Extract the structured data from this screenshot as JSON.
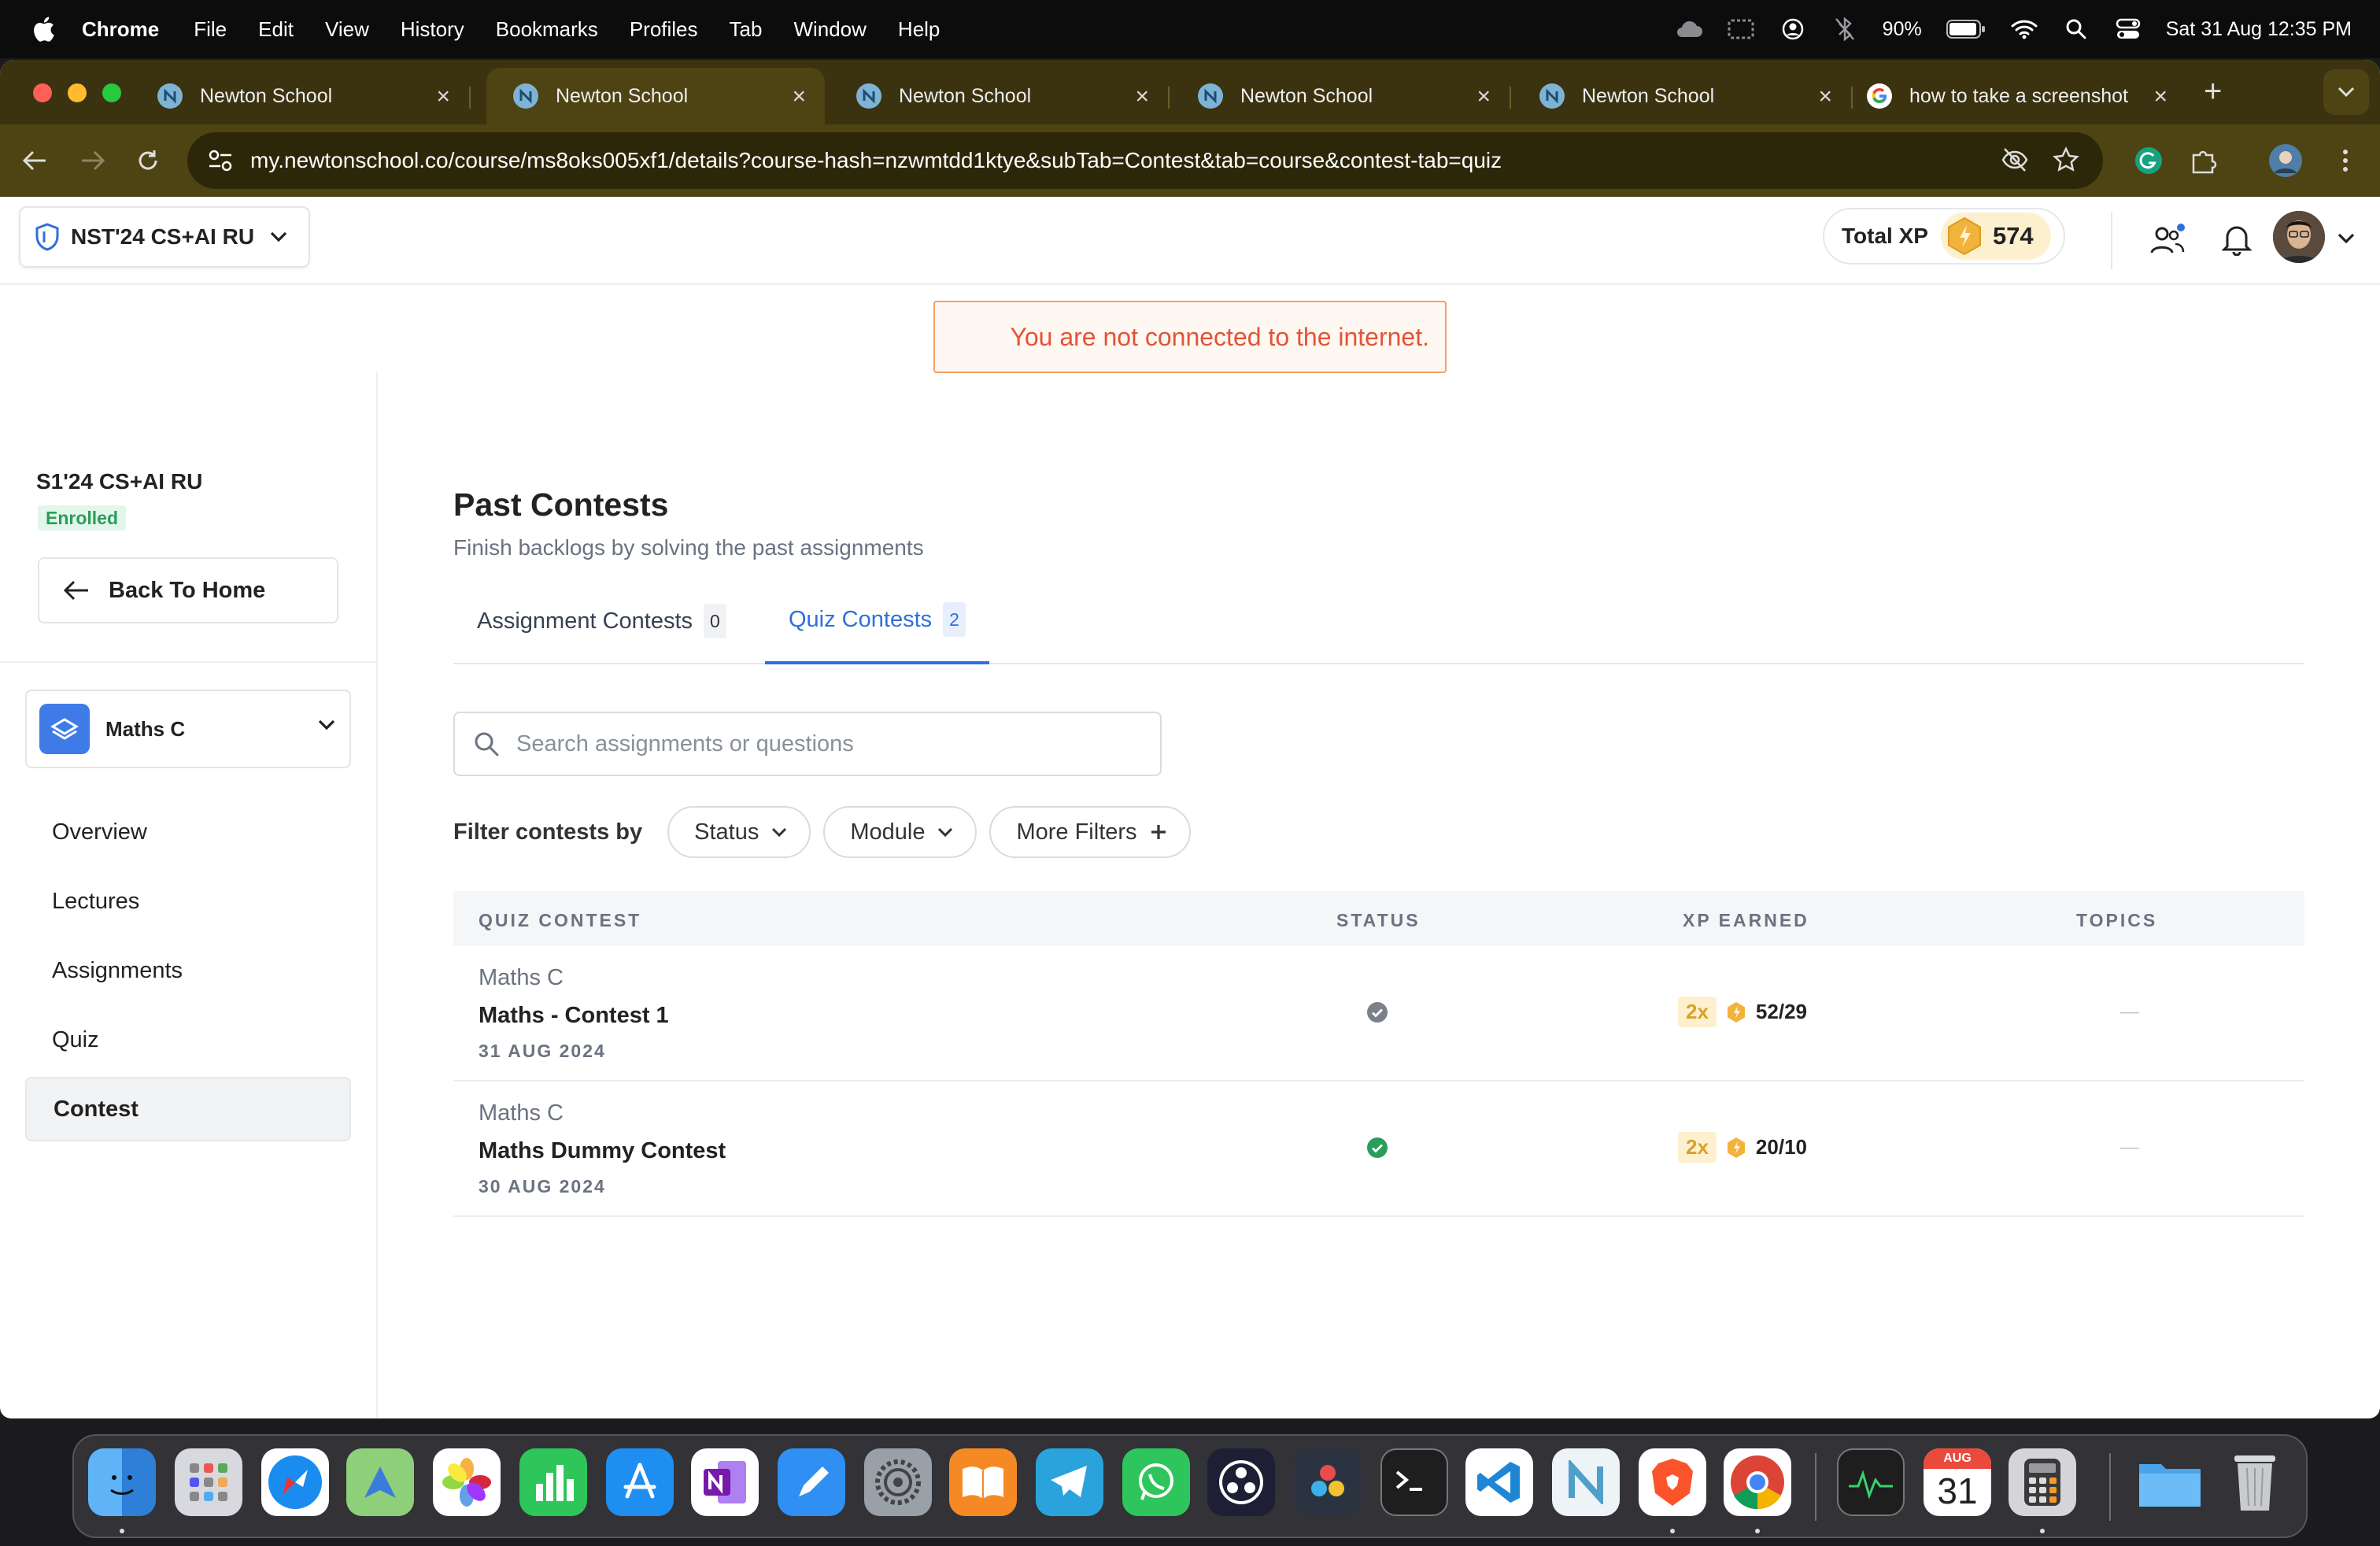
{
  "menubar": {
    "app": "Chrome",
    "items": [
      "File",
      "Edit",
      "View",
      "History",
      "Bookmarks",
      "Profiles",
      "Tab",
      "Window",
      "Help"
    ],
    "battery": "90%",
    "datetime": "Sat 31 Aug  12:35 PM"
  },
  "browser": {
    "tabs": [
      {
        "title": "Newton School",
        "active": false
      },
      {
        "title": "Newton School",
        "active": true
      },
      {
        "title": "Newton School",
        "active": false
      },
      {
        "title": "Newton School",
        "active": false
      },
      {
        "title": "Newton School",
        "active": false
      },
      {
        "title": "how to take a screenshot",
        "active": false
      }
    ],
    "url": "my.newtonschool.co/course/ms8oks005xf1/details?course-hash=nzwmtdd1ktye&subTab=Contest&tab=course&contest-tab=quiz"
  },
  "header": {
    "course_switcher": "NST'24 CS+AI RU",
    "total_xp_label": "Total XP",
    "total_xp_value": "574"
  },
  "alert": {
    "message": "You are not connected to the internet."
  },
  "sidebar": {
    "course_title": "S1'24 CS+AI RU",
    "enrolled_badge": "Enrolled",
    "back_button": "Back To Home",
    "subject": "Maths C",
    "nav": [
      {
        "label": "Overview",
        "active": false
      },
      {
        "label": "Lectures",
        "active": false
      },
      {
        "label": "Assignments",
        "active": false
      },
      {
        "label": "Quiz",
        "active": false
      },
      {
        "label": "Contest",
        "active": true
      }
    ]
  },
  "main": {
    "title": "Past Contests",
    "subtitle": "Finish backlogs by solving the past assignments",
    "tabs": [
      {
        "label": "Assignment Contests",
        "count": "0",
        "active": false
      },
      {
        "label": "Quiz Contests",
        "count": "2",
        "active": true
      }
    ],
    "search_placeholder": "Search assignments or questions",
    "filter_label": "Filter contests by",
    "filters": [
      "Status",
      "Module",
      "More Filters"
    ],
    "table": {
      "columns": [
        "QUIZ CONTEST",
        "STATUS",
        "XP EARNED",
        "TOPICS"
      ],
      "rows": [
        {
          "subject": "Maths C",
          "name": "Maths - Contest 1",
          "date": "31 AUG 2024",
          "status": "completed-grey",
          "multiplier": "2x",
          "xp": "52/29",
          "topics": "—"
        },
        {
          "subject": "Maths C",
          "name": "Maths Dummy Contest",
          "date": "30 AUG 2024",
          "status": "completed-green",
          "multiplier": "2x",
          "xp": "20/10",
          "topics": "—"
        }
      ]
    }
  },
  "colors": {
    "accent": "#2f6fdc",
    "alert_text": "#e25436",
    "alert_border": "#f0a06a",
    "status_green": "#2a9d5c",
    "status_grey": "#7c8189"
  },
  "dock": {
    "apps": [
      "finder-icon",
      "launchpad-icon",
      "safari-icon",
      "maps-icon",
      "photos-icon",
      "numbers-icon",
      "app-store-icon",
      "onenote-icon",
      "pages-icon",
      "system-settings-icon",
      "books-icon",
      "telegram-icon",
      "whatsapp-icon",
      "obs-icon",
      "davinci-icon",
      "terminal-icon",
      "vscode-icon",
      "newton-school-icon",
      "brave-icon",
      "chrome-icon",
      "activity-monitor-icon",
      "calendar-icon",
      "calculator-icon",
      "files-folder-icon",
      "trash-icon"
    ],
    "calendar_month": "AUG",
    "calendar_day": "31"
  }
}
